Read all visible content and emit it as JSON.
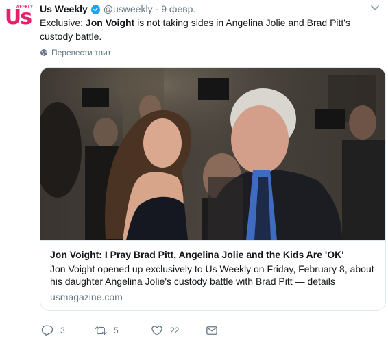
{
  "author": {
    "avatar_text": "Us",
    "avatar_sup": "WEEKLY",
    "name": "Us Weekly",
    "handle": "@usweekly",
    "separator": "·",
    "date": "9 февр."
  },
  "tweet": {
    "text_prefix": "Exclusive: ",
    "text_bold": "Jon Voight",
    "text_suffix": " is not taking sides in Angelina Jolie and Brad Pitt's custody battle.",
    "translate_label": "Перевести твит"
  },
  "card": {
    "title": "Jon Voight: I Pray Brad Pitt, Angelina Jolie and the Kids Are 'OK'",
    "description": "Jon Voight opened up exclusively to Us Weekly on Friday, February 8, about his daughter Angelina Jolie's custody battle with Brad Pitt — details",
    "domain": "usmagazine.com"
  },
  "actions": {
    "reply_count": "3",
    "retweet_count": "5",
    "like_count": "22"
  },
  "colors": {
    "brand": "#e5206c",
    "verified": "#1da1f2",
    "secondary_text": "#657786",
    "border": "#e1e8ed"
  }
}
